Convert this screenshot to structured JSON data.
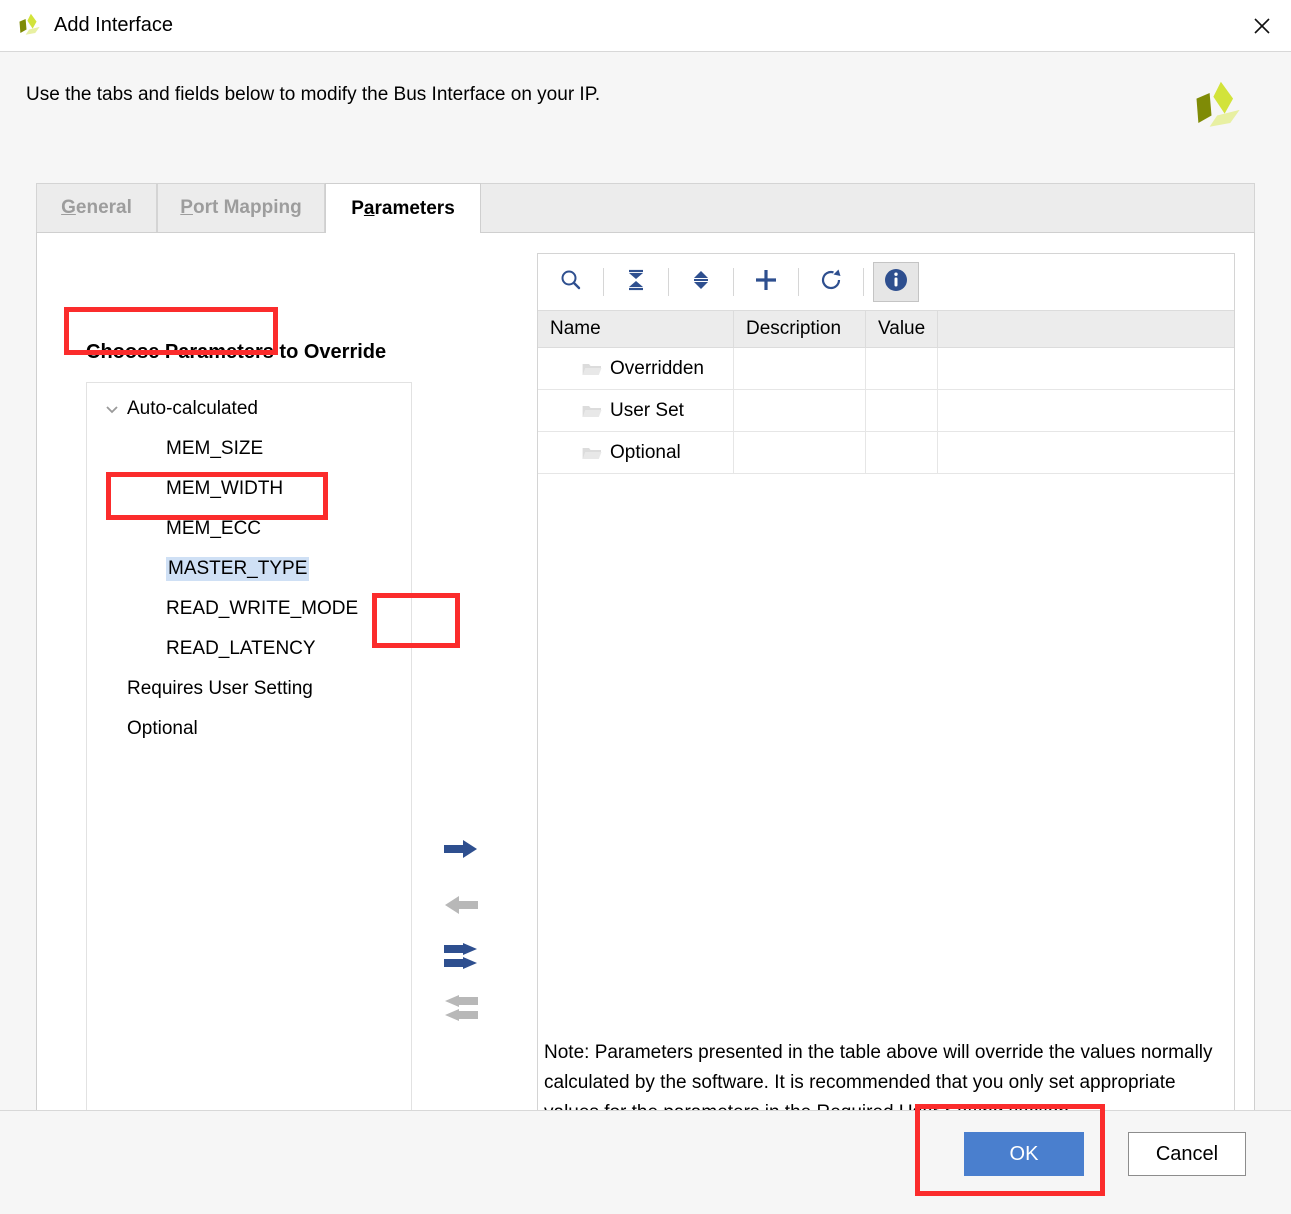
{
  "window": {
    "title": "Add Interface",
    "logo_icon": "altera-logo-icon",
    "close_icon": "close-icon"
  },
  "header": {
    "instruction": "Use the tabs and fields below to modify the Bus Interface on your IP.",
    "brand_logo_icon": "altera-logo-icon"
  },
  "tabs": [
    {
      "id": "general",
      "label": "General",
      "mnemonic": "G",
      "selected": false
    },
    {
      "id": "port-mapping",
      "label": "Port Mapping",
      "mnemonic": "P",
      "selected": false
    },
    {
      "id": "parameters",
      "label": "Parameters",
      "mnemonic": "a",
      "selected": true
    }
  ],
  "left_panel": {
    "title": "Choose Parameters to Override",
    "tree": [
      {
        "label": "Auto-calculated",
        "level": "root",
        "expanded": true,
        "icon": "chevron-down-icon",
        "selected": false
      },
      {
        "label": "MEM_SIZE",
        "level": "child",
        "selected": false
      },
      {
        "label": "MEM_WIDTH",
        "level": "child",
        "selected": false
      },
      {
        "label": "MEM_ECC",
        "level": "child",
        "selected": false
      },
      {
        "label": "MASTER_TYPE",
        "level": "child",
        "selected": true
      },
      {
        "label": "READ_WRITE_MODE",
        "level": "child",
        "selected": false
      },
      {
        "label": "READ_LATENCY",
        "level": "child",
        "selected": false
      },
      {
        "label": "Requires User Setting",
        "level": "root2",
        "selected": false
      },
      {
        "label": "Optional",
        "level": "root2",
        "selected": false
      }
    ]
  },
  "transfer_buttons": [
    {
      "id": "move-right",
      "icon": "arrow-right-icon",
      "enabled": true
    },
    {
      "id": "move-left",
      "icon": "arrow-left-icon",
      "enabled": false
    },
    {
      "id": "move-all-right",
      "icon": "double-arrow-right-icon",
      "enabled": true
    },
    {
      "id": "move-all-left",
      "icon": "double-arrow-left-icon",
      "enabled": false
    }
  ],
  "right_panel": {
    "toolbar": [
      {
        "id": "search",
        "icon": "search-icon",
        "active": false
      },
      {
        "id": "collapse-all",
        "icon": "collapse-all-icon",
        "active": false
      },
      {
        "id": "expand-all",
        "icon": "expand-all-icon",
        "active": false
      },
      {
        "id": "add",
        "icon": "plus-icon",
        "active": false
      },
      {
        "id": "refresh",
        "icon": "refresh-icon",
        "active": false
      },
      {
        "id": "info",
        "icon": "info-icon",
        "active": true
      }
    ],
    "table": {
      "columns": [
        "Name",
        "Description",
        "Value",
        ""
      ],
      "rows": [
        {
          "name": "Overridden",
          "description": "",
          "value": "",
          "icon": "folder-icon"
        },
        {
          "name": "User Set",
          "description": "",
          "value": "",
          "icon": "folder-icon"
        },
        {
          "name": "Optional",
          "description": "",
          "value": "",
          "icon": "folder-icon"
        }
      ]
    },
    "note": "Note: Parameters presented in the table above will override the values normally calculated by the software. It is recommended that you only set appropriate values for the parameters in the Required User Setting section."
  },
  "footer": {
    "ok_label": "OK",
    "cancel_label": "Cancel"
  },
  "colors": {
    "accent_blue": "#2e4f8f",
    "ok_button": "#4a7fce",
    "selection": "#cfe0f5",
    "annotation_red": "#fb2c2c",
    "disabled_gray": "#b8b8b8",
    "logo_green_dark": "#7f8b06",
    "logo_green_mid": "#d2e33a",
    "logo_green_light": "#e8f0a2"
  }
}
